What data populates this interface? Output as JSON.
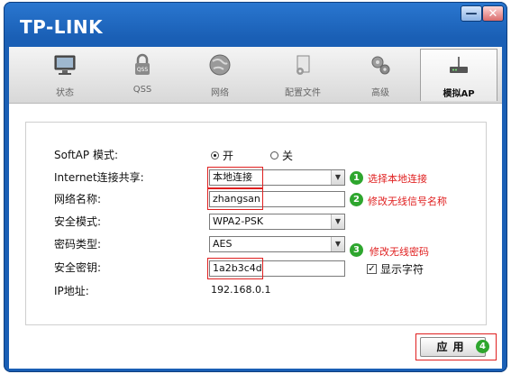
{
  "app": {
    "brand": "TP-LINK"
  },
  "window_controls": {
    "minimize": "—",
    "close": "✕"
  },
  "tabs": [
    {
      "label": "状态",
      "icon": "monitor-icon"
    },
    {
      "label": "QSS",
      "icon": "qss-lock-icon"
    },
    {
      "label": "网络",
      "icon": "globe-icon"
    },
    {
      "label": "配置文件",
      "icon": "config-file-icon"
    },
    {
      "label": "高级",
      "icon": "gears-icon"
    },
    {
      "label": "模拟AP",
      "icon": "router-icon",
      "active": true
    }
  ],
  "form": {
    "softap_label": "SoftAP 模式:",
    "on_label": "开",
    "off_label": "关",
    "selected_mode": "开",
    "share_label": "Internet连接共享:",
    "share_value": "本地连接",
    "ssid_label": "网络名称:",
    "ssid_value": "zhangsan",
    "security_label": "安全模式:",
    "security_value": "WPA2-PSK",
    "cipher_label": "密码类型:",
    "cipher_value": "AES",
    "key_label": "安全密钥:",
    "key_value": "1a2b3c4d",
    "show_chars_label": "显示字符",
    "show_chars_checked": true,
    "ip_label": "IP地址:",
    "ip_value": "192.168.0.1"
  },
  "annotations": [
    {
      "num": "1",
      "text": "选择本地连接"
    },
    {
      "num": "2",
      "text": "修改无线信号名称"
    },
    {
      "num": "3",
      "text": "修改无线密码"
    },
    {
      "num": "4",
      "text": ""
    }
  ],
  "apply_label": "应用",
  "colors": {
    "title_blue": "#1a5fb5",
    "highlight_red": "#e02020",
    "badge_green": "#2ea62e"
  }
}
